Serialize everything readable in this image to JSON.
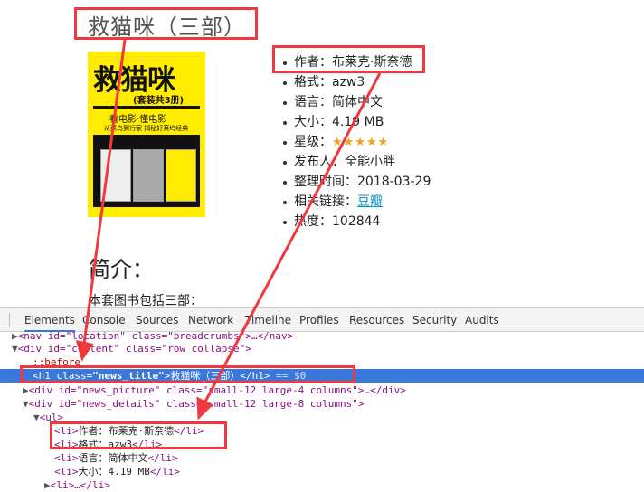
{
  "page": {
    "title": "救猫咪（三部）",
    "cover": {
      "title": "救猫咪",
      "set": "(套装共3册)",
      "slogan": "看电影·懂电影",
      "sub": "从菜鸟到行家 揭秘好莱坞经典"
    },
    "details": [
      {
        "label": "作者：",
        "value": "布莱克·斯奈德"
      },
      {
        "label": "格式：",
        "value": "azw3"
      },
      {
        "label": "语言：",
        "value": "简体中文"
      },
      {
        "label": "大小：",
        "value": "4.19 MB"
      },
      {
        "label": "星级：",
        "value": "★★★★★",
        "rating": 5
      },
      {
        "label": "发布人：",
        "value": "全能小胖"
      },
      {
        "label": "整理时间：",
        "value": "2018-03-29"
      },
      {
        "label": "相关链接：",
        "value": "豆瓣",
        "is_link": true
      },
      {
        "label": "热度：",
        "value": "102844"
      }
    ],
    "intro_heading": "简介：",
    "intro_text": "本套图书包括三部："
  },
  "devtools": {
    "tabs": [
      "Elements",
      "Console",
      "Sources",
      "Network",
      "Timeline",
      "Profiles",
      "Resources",
      "Security",
      "Audits"
    ],
    "active_tab": "Elements",
    "lines": {
      "nav": "<nav id=\"location\" class=\"breadcrumbs\">…</nav>",
      "content_open": "<div id=\"content\" class=\"row collapse\">",
      "before": "::before",
      "h1_tag_open": "<h1 ",
      "h1_attr": "class=",
      "h1_val": "\"news_title\"",
      "h1_text": ">救猫咪（三部）",
      "h1_close": "</h1>",
      "h1_eq": " == $0",
      "picture": "<div id=\"news_picture\" class=\"small-12 large-4 columns\">…</div>",
      "details": "<div id=\"news_details\" class=\"small-12 large-8 columns\">",
      "ul": "<ul>",
      "li": [
        "作者：布莱克·斯奈德",
        "格式：azw3",
        "语言：简体中文",
        "大小：4.19 MB"
      ],
      "li_collapsed": "<li>…</li>"
    }
  },
  "colors": {
    "annotation": "#f0393e",
    "selection": "#3879d9",
    "link": "#0a8fc7",
    "star": "#f0a020"
  }
}
